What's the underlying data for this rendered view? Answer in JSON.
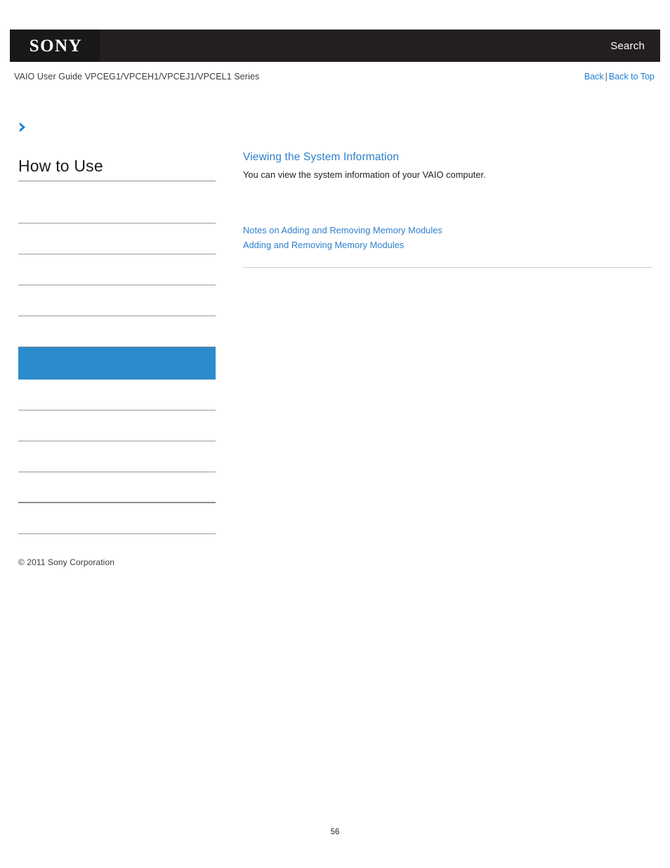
{
  "header": {
    "logo_text": "SONY",
    "search_label": "Search"
  },
  "subheader": {
    "guide_title": "VAIO User Guide VPCEG1/VPCEH1/VPCEJ1/VPCEL1 Series",
    "back_label": "Back",
    "separator": "|",
    "back_to_top_label": "Back to Top"
  },
  "sidebar": {
    "breadcrumb_icon": "chevron-right-icon",
    "title": "How to Use",
    "items": [
      {
        "label": "",
        "active": false,
        "thick": false
      },
      {
        "label": "",
        "active": false,
        "thick": false
      },
      {
        "label": "",
        "active": false,
        "thick": false
      },
      {
        "label": "",
        "active": false,
        "thick": false
      },
      {
        "label": "",
        "active": false,
        "thick": false
      },
      {
        "label": "",
        "active": true,
        "thick": false
      },
      {
        "label": "",
        "active": false,
        "thick": false
      },
      {
        "label": "",
        "active": false,
        "thick": false
      },
      {
        "label": "",
        "active": false,
        "thick": false
      },
      {
        "label": "",
        "active": false,
        "thick": true
      },
      {
        "label": "",
        "active": false,
        "thick": false
      }
    ],
    "copyright": "© 2011 Sony Corporation"
  },
  "content": {
    "title": "Viewing the System Information",
    "description": "You can view the system information of your VAIO computer.",
    "related_links": [
      "Notes on Adding and Removing Memory Modules",
      "Adding and Removing Memory Modules"
    ]
  },
  "footer": {
    "page_number": "56"
  },
  "colors": {
    "header_bg": "#231f20",
    "logo_bg": "#1a1718",
    "link_blue": "#2e7fcc",
    "nav_blue": "#1a7fd4",
    "active_blue": "#2b8bcb",
    "divider": "#9a9a9a"
  }
}
